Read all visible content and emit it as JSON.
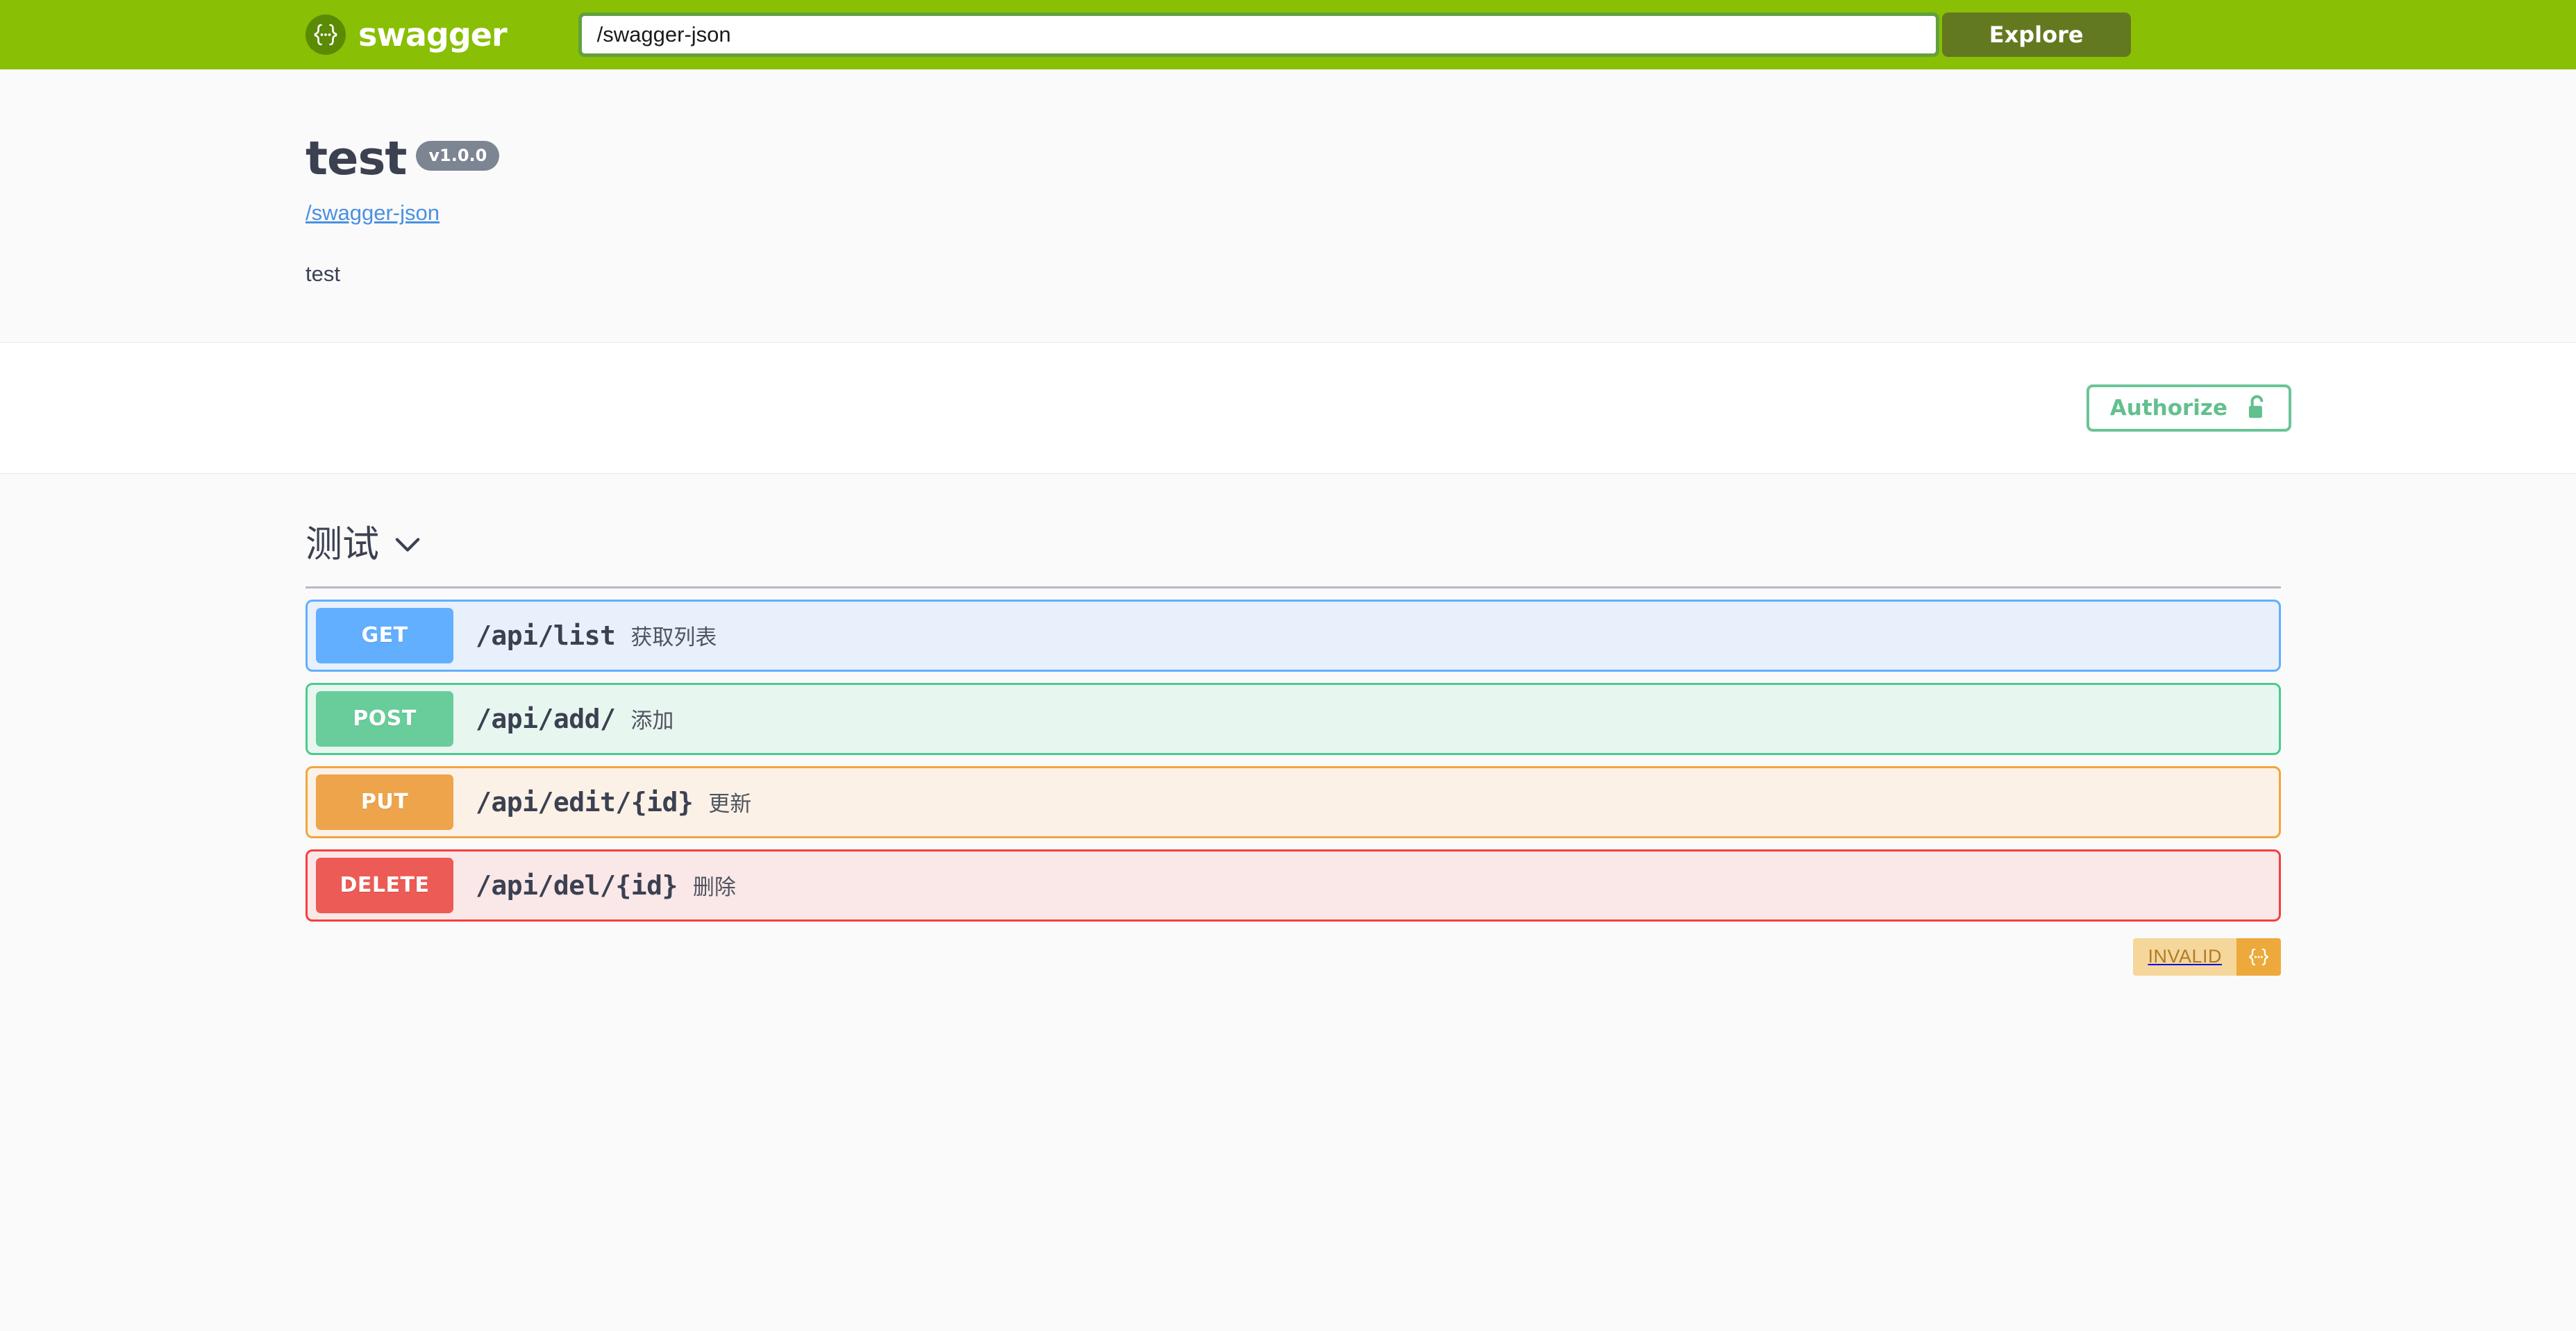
{
  "topbar": {
    "logo_text": "swagger",
    "logo_icon": "swagger-braces-icon",
    "url_value": "/swagger-json",
    "url_placeholder": "/swagger-json",
    "explore_label": "Explore",
    "background_color": "#89bf04"
  },
  "info": {
    "title": "test",
    "version": "v1.0.0",
    "definition_link": "/swagger-json",
    "description": "test"
  },
  "auth": {
    "authorize_label": "Authorize",
    "lock_icon": "unlock-icon",
    "accent_color": "#62c08e"
  },
  "tag": {
    "name": "测试",
    "chevron_icon": "chevron-down-icon"
  },
  "operations": [
    {
      "method": "GET",
      "path": "/api/list",
      "summary": "获取列表",
      "color": "#61affe",
      "style": "op-get"
    },
    {
      "method": "POST",
      "path": "/api/add/",
      "summary": "添加",
      "color": "#49cc90",
      "style": "op-post"
    },
    {
      "method": "PUT",
      "path": "/api/edit/{id}",
      "summary": "更新",
      "color": "#f1a53f",
      "style": "op-put"
    },
    {
      "method": "DELETE",
      "path": "/api/del/{id}",
      "summary": "删除",
      "color": "#f93e3e",
      "style": "op-delete"
    }
  ],
  "validator": {
    "label": "INVALID",
    "icon": "swagger-braces-icon",
    "label_color": "#b07b26",
    "icon_background": "#eda93b"
  }
}
